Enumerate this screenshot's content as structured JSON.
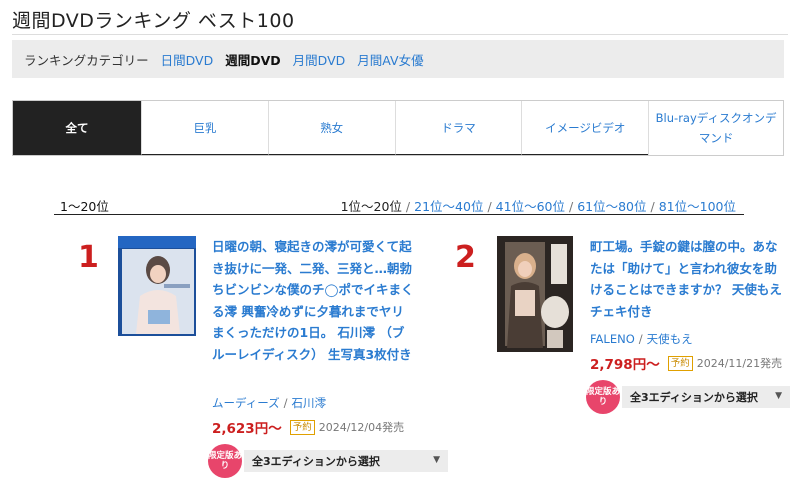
{
  "page_title": "週間DVDランキング ベスト100",
  "category": {
    "label": "ランキングカテゴリー",
    "links": [
      "日間DVD",
      "週間DVD",
      "月間DVD",
      "月間AV女優"
    ],
    "current": "週間DVD"
  },
  "tabs": [
    "全て",
    "巨乳",
    "熟女",
    "ドラマ",
    "イメージビデオ",
    "Blu-rayディスクオンデマンド"
  ],
  "range": {
    "current": "1〜20位",
    "pages": [
      "1位〜20位",
      "21位〜40位",
      "41位〜60位",
      "61位〜80位",
      "81位〜100位"
    ],
    "separator": "/"
  },
  "items": [
    {
      "rank": "1",
      "title": "日曜の朝、寝起きの澪が可愛くて起き抜けに一発、二発、三発と…朝勃ちビンビンな僕のチ◯ポでイキまくる澪 興奮冷めずに夕暮れまでヤリまくっただけの1日。 石川澪 （ブルーレイディスク） 生写真3枚付き",
      "maker": "ムーディーズ",
      "actress": "石川澪",
      "price": "2,623円〜",
      "badge": "予約",
      "date": "2024/12/04発売",
      "limited": "限定版あり",
      "edition": "全3エディションから選択",
      "arrow": "▼"
    },
    {
      "rank": "2",
      "title": "町工場。手錠の鍵は膣の中。あなたは「助けて」と言われ彼女を助けることはできますか？ 天使もえ チェキ付き",
      "maker": "FALENO",
      "actress": "天使もえ",
      "price": "2,798円〜",
      "badge": "予約",
      "date": "2024/11/21発売",
      "limited": "限定版あり",
      "edition": "全3エディションから選択",
      "arrow": "▼"
    }
  ],
  "colors": {
    "link": "#2a7bd0",
    "price": "#cc1f1f",
    "rank": "#cc1f1f",
    "limited": "#e8456b",
    "active_tab": "#222222"
  }
}
